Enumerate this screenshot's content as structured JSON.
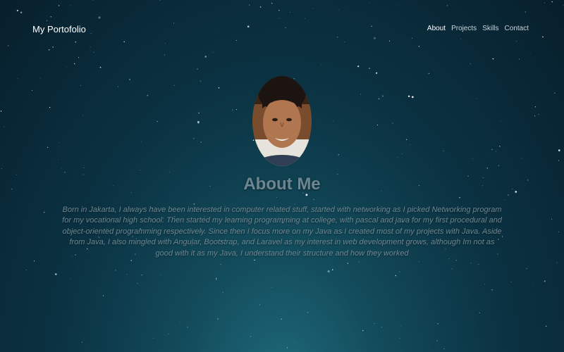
{
  "navbar": {
    "brand": "My Portofolio",
    "links": [
      {
        "label": "About",
        "active": true
      },
      {
        "label": "Projects",
        "active": false
      },
      {
        "label": "Skills",
        "active": false
      },
      {
        "label": "Contact",
        "active": false
      }
    ]
  },
  "about": {
    "title": "About Me",
    "body": "Born in Jakarta, I always have been interested in computer related stuff, started with networking as I picked Networking program for my vocational high school. Then started my learning programming at college, with pascal and java for my first procedural and object-oriented programming respectively. Since then I focus more on my Java as I created most of my projects with Java. Aside from Java, I also mingled with Angular, Bootstrap, and Laravel as my interest in web development grows, although Im not as good with it as my Java, I understand their structure and how they worked"
  },
  "colors": {
    "background_top": "#071f2c",
    "background_glow": "#1e6a7a",
    "nav_text": "#c9d3da",
    "content_text": "#6e8690"
  }
}
